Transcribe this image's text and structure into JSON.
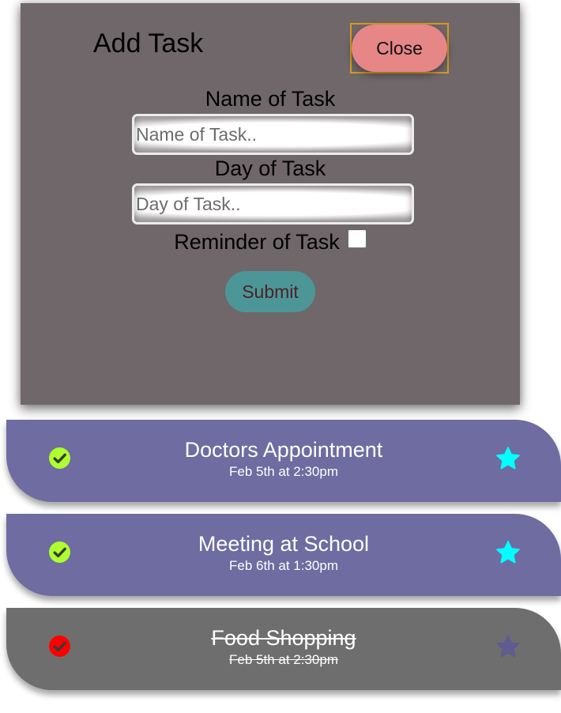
{
  "modal": {
    "title": "Add Task",
    "close_label": "Close",
    "name_label": "Name of Task",
    "name_placeholder": "Name of Task..",
    "name_value": "",
    "day_label": "Day of Task",
    "day_placeholder": "Day of Task..",
    "day_value": "",
    "reminder_label": "Reminder of Task",
    "reminder_checked": false,
    "submit_label": "Submit"
  },
  "tasks": [
    {
      "title": "Doctors Appointment",
      "date": "Feb 5th at 2:30pm",
      "completed": false,
      "check_icon": "check-circle-icon",
      "check_color": "#adff2f",
      "star_icon": "star-icon",
      "star_color": "#00ffff"
    },
    {
      "title": "Meeting at School",
      "date": "Feb 6th at 1:30pm",
      "completed": false,
      "check_icon": "check-circle-icon",
      "check_color": "#adff2f",
      "star_icon": "star-icon",
      "star_color": "#00ffff"
    },
    {
      "title": "Food Shopping",
      "date": "Feb 5th at 2:30pm",
      "completed": true,
      "check_icon": "check-circle-icon",
      "check_color": "#ff0000",
      "star_icon": "star-icon",
      "star_color": "#5f5c8f"
    }
  ],
  "colors": {
    "modal_background": "#6f6769",
    "close_button": "#e78686",
    "close_outline": "#d79b1c",
    "submit_button": "#4d9698",
    "submit_text": "#4a2226",
    "task_active": "#6e6ca1",
    "task_done": "#6e6e6e"
  }
}
